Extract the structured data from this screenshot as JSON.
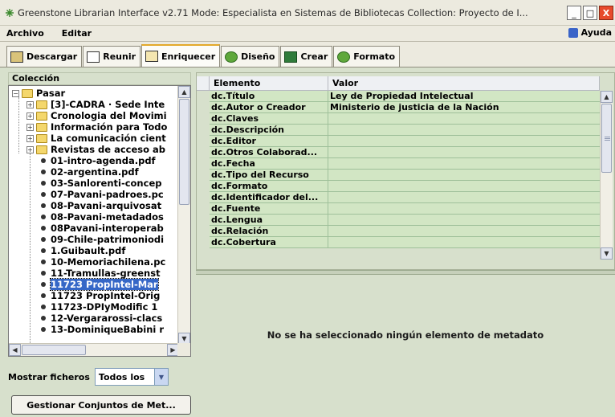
{
  "window": {
    "title": "Greenstone Librarian Interface v2.71  Mode: Especialista en Sistemas de Bibliotecas  Collection: Proyecto de I...",
    "minimize": "_",
    "maximize": "□",
    "close": "X"
  },
  "menu": {
    "items": [
      "Archivo",
      "Editar"
    ],
    "help": "Ayuda"
  },
  "tabs": [
    {
      "label": "Descargar",
      "icon": "download-icon"
    },
    {
      "label": "Reunir",
      "icon": "gather-icon"
    },
    {
      "label": "Enriquecer",
      "icon": "enrich-icon",
      "active": true
    },
    {
      "label": "Diseño",
      "icon": "gear-icon"
    },
    {
      "label": "Crear",
      "icon": "create-icon"
    },
    {
      "label": "Formato",
      "icon": "gear-icon"
    }
  ],
  "collection": {
    "header": "Colección",
    "root": "Pasar",
    "folders": [
      "[3]-CADRA · Sede Inte",
      "Cronologia del Movimi",
      "Información para Todo",
      "La comunicación cient",
      "Revistas de acceso ab"
    ],
    "files": [
      "01-intro-agenda.pdf",
      "02-argentina.pdf",
      "03-Sanlorenti-concep",
      "07-Pavani-padroes.pc",
      "08-Pavani-arquivosat",
      "08-Pavani-metadados",
      "08Pavani-interoperab",
      "09-Chile-patrimoniodi",
      "1.Guibault.pdf",
      "10-Memoriachilena.pc",
      "11-Tramullas-greenst",
      "11723 PropIntel-Mar",
      "11723 PropIntel-Orig",
      "11723-DPIyModific 1",
      "12-Vergararossi-clacs",
      "13-DominiqueBabini r"
    ],
    "selected_file": "11723 PropIntel-Mar",
    "show_files_label": "Mostrar ficheros",
    "show_files_value": "Todos los",
    "manage_button": "Gestionar Conjuntos de Met..."
  },
  "metadata": {
    "columns": [
      "Elemento",
      "Valor"
    ],
    "rows": [
      {
        "element": "dc.Título",
        "value": "Ley de Propiedad Intelectual"
      },
      {
        "element": "dc.Autor o Creador",
        "value": "Ministerio de justicia de la Nación"
      },
      {
        "element": "dc.Claves",
        "value": ""
      },
      {
        "element": "dc.Descripción",
        "value": ""
      },
      {
        "element": "dc.Editor",
        "value": ""
      },
      {
        "element": "dc.Otros Colaborad...",
        "value": ""
      },
      {
        "element": "dc.Fecha",
        "value": ""
      },
      {
        "element": "dc.Tipo del Recurso",
        "value": ""
      },
      {
        "element": "dc.Formato",
        "value": ""
      },
      {
        "element": "dc.Identificador del...",
        "value": ""
      },
      {
        "element": "dc.Fuente",
        "value": ""
      },
      {
        "element": "dc.Lengua",
        "value": ""
      },
      {
        "element": "dc.Relación",
        "value": ""
      },
      {
        "element": "dc.Cobertura",
        "value": ""
      }
    ],
    "empty_message": "No se ha seleccionado ningún elemento de metadato"
  }
}
